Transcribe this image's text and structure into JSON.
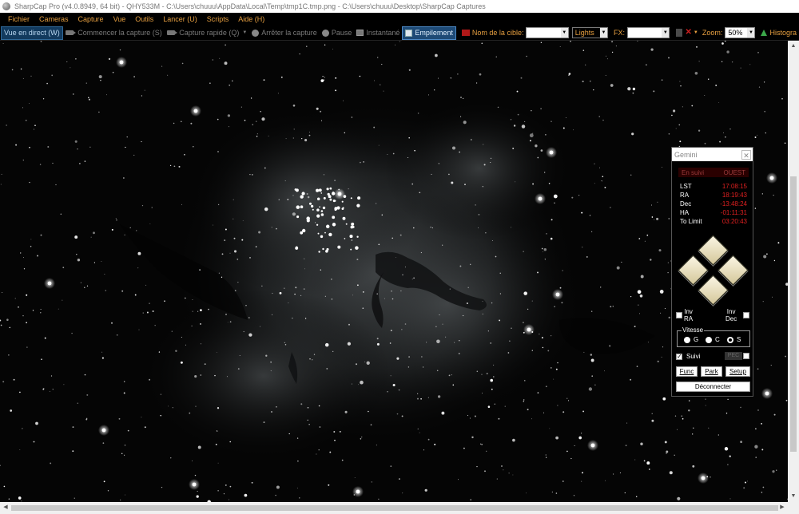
{
  "window": {
    "title": "SharpCap Pro (v4.0.8949, 64 bit) - QHY533M - C:\\Users\\chuuu\\AppData\\Local\\Temp\\tmp1C.tmp.png - C:\\Users\\chuuu\\Desktop\\SharpCap Captures"
  },
  "menu": [
    "Fichier",
    "Cameras",
    "Capture",
    "Vue",
    "Outils",
    "Lancer (U)",
    "Scripts",
    "Aide (H)"
  ],
  "toolbar": {
    "live_view": "Vue en direct (W)",
    "start_capture": "Commencer la capture (S)",
    "quick_capture": "Capture rapide (Q)",
    "stop_capture": "Arrêter la capture",
    "pause": "Pause",
    "snapshot": "Instantané",
    "stacking": "Empilement",
    "target_label": "Nom de la cible:",
    "target_value": "",
    "frame_type": "Lights",
    "fx_label": "FX:",
    "fx_value": "",
    "zoom_label": "Zoom:",
    "zoom_value": "50%",
    "histogram": "Histogra"
  },
  "gemini": {
    "title": "Gemini",
    "status_left": "En suivi",
    "status_right": "OUEST",
    "rows": [
      {
        "label": "LST",
        "value": "17:08:15"
      },
      {
        "label": "RA",
        "value": "18:19:43"
      },
      {
        "label": "Dec",
        "value": "-13:48:24"
      },
      {
        "label": "HA",
        "value": "-01:11:31"
      },
      {
        "label": "To Limit",
        "value": "03:20:43"
      }
    ],
    "inv_ra": "Inv\nRA",
    "inv_dec": "Inv\nDec",
    "inv_ra_l1": "Inv",
    "inv_ra_l2": "RA",
    "inv_dec_l1": "Inv",
    "inv_dec_l2": "Dec",
    "speed_legend": "Vitesse",
    "speeds": [
      "G",
      "C",
      "S"
    ],
    "selected_speed": "S",
    "tracking_label": "Suivi",
    "tracking_checked": true,
    "pec_label": "PEC",
    "btn_func": "Func",
    "btn_park": "Park",
    "btn_setup": "Setup",
    "btn_disconnect": "Déconnecter"
  },
  "colors": {
    "menu_text": "#e8a040",
    "value_red": "#e02020",
    "nebula": "#9aa4aa"
  }
}
